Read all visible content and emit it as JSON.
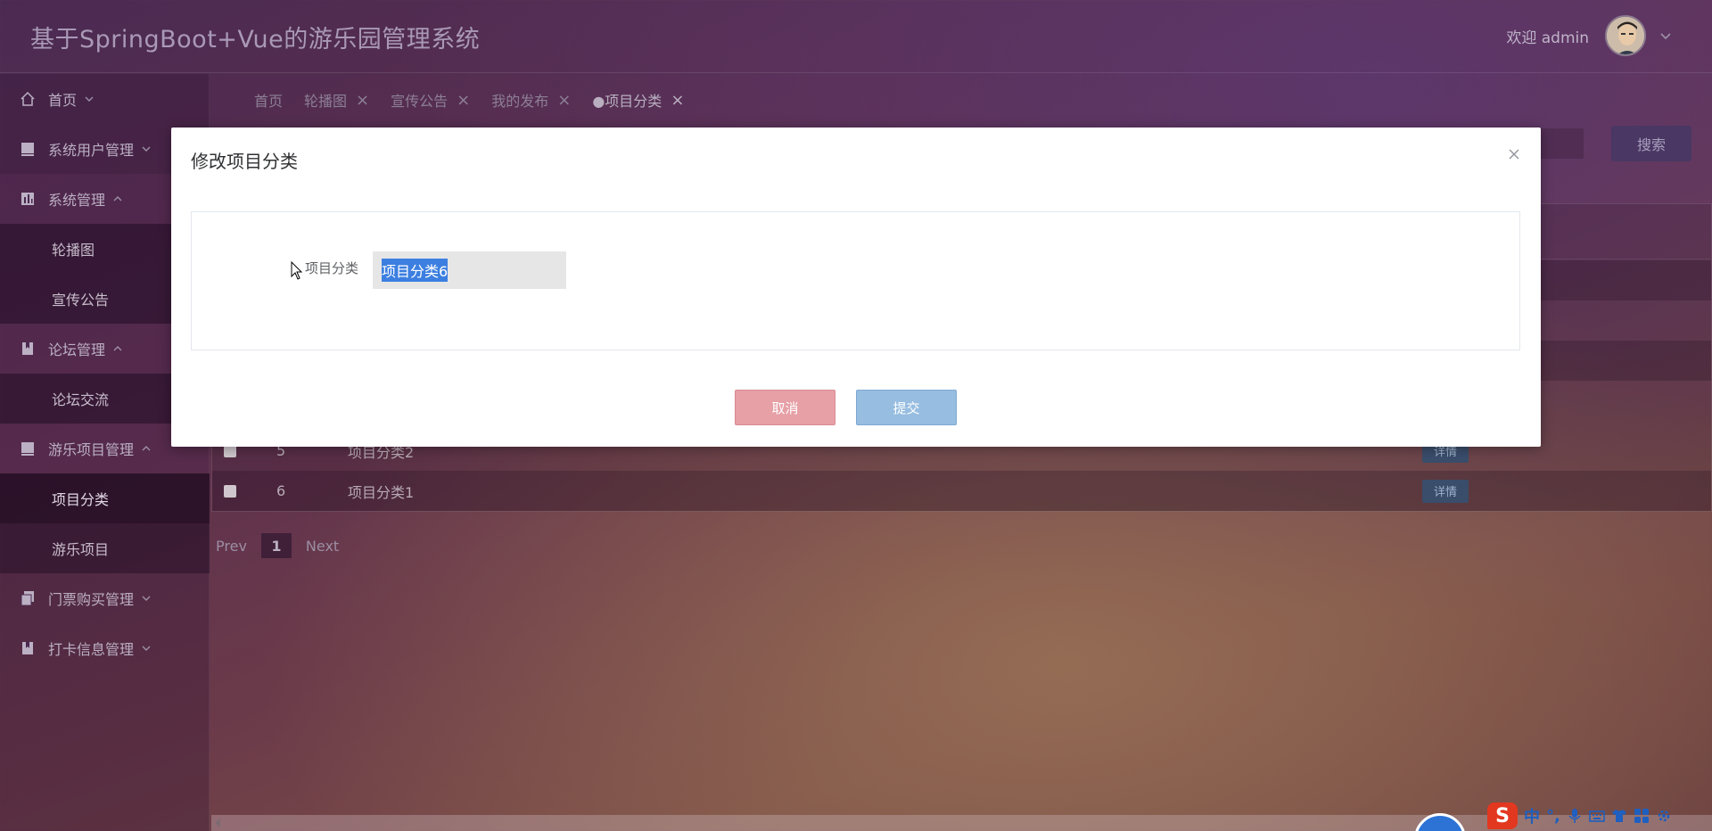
{
  "header": {
    "app_title": "基于SpringBoot+Vue的游乐园管理系统",
    "welcome_text": "欢迎 admin"
  },
  "sidebar": {
    "items": [
      {
        "label": "首页",
        "icon": "home-icon"
      },
      {
        "label": "系统用户管理",
        "icon": "monitor-icon"
      },
      {
        "label": "系统管理",
        "icon": "chart-icon"
      },
      {
        "label": "轮播图",
        "icon": ""
      },
      {
        "label": "宣传公告",
        "icon": ""
      },
      {
        "label": "论坛管理",
        "icon": "book-icon"
      },
      {
        "label": "论坛交流",
        "icon": ""
      },
      {
        "label": "游乐项目管理",
        "icon": "monitor-icon"
      },
      {
        "label": "项目分类",
        "icon": ""
      },
      {
        "label": "游乐项目",
        "icon": ""
      },
      {
        "label": "门票购买管理",
        "icon": "copy-icon"
      },
      {
        "label": "打卡信息管理",
        "icon": "book-icon"
      }
    ]
  },
  "tabs": [
    {
      "label": "首页"
    },
    {
      "label": "轮播图"
    },
    {
      "label": "宣传公告"
    },
    {
      "label": "我的发布"
    },
    {
      "label": "●项目分类"
    }
  ],
  "toolbar": {
    "search_label": "搜索"
  },
  "table": {
    "rows": [
      {
        "index": "5",
        "name": "项目分类2",
        "action": "详情"
      },
      {
        "index": "6",
        "name": "项目分类1",
        "action": "详情"
      }
    ]
  },
  "pagination": {
    "prev": "Prev",
    "current": "1",
    "next": "Next"
  },
  "modal": {
    "title": "修改项目分类",
    "field_label": "项目分类",
    "field_value": "项目分类6",
    "cancel_label": "取消",
    "submit_label": "提交"
  },
  "ime": {
    "logo": "S",
    "mode": "中",
    "punct": "°,"
  },
  "colors": {
    "cancel_button": "#e6a0a6",
    "submit_button": "#97bde0",
    "text_selection": "#3c7fe0"
  }
}
